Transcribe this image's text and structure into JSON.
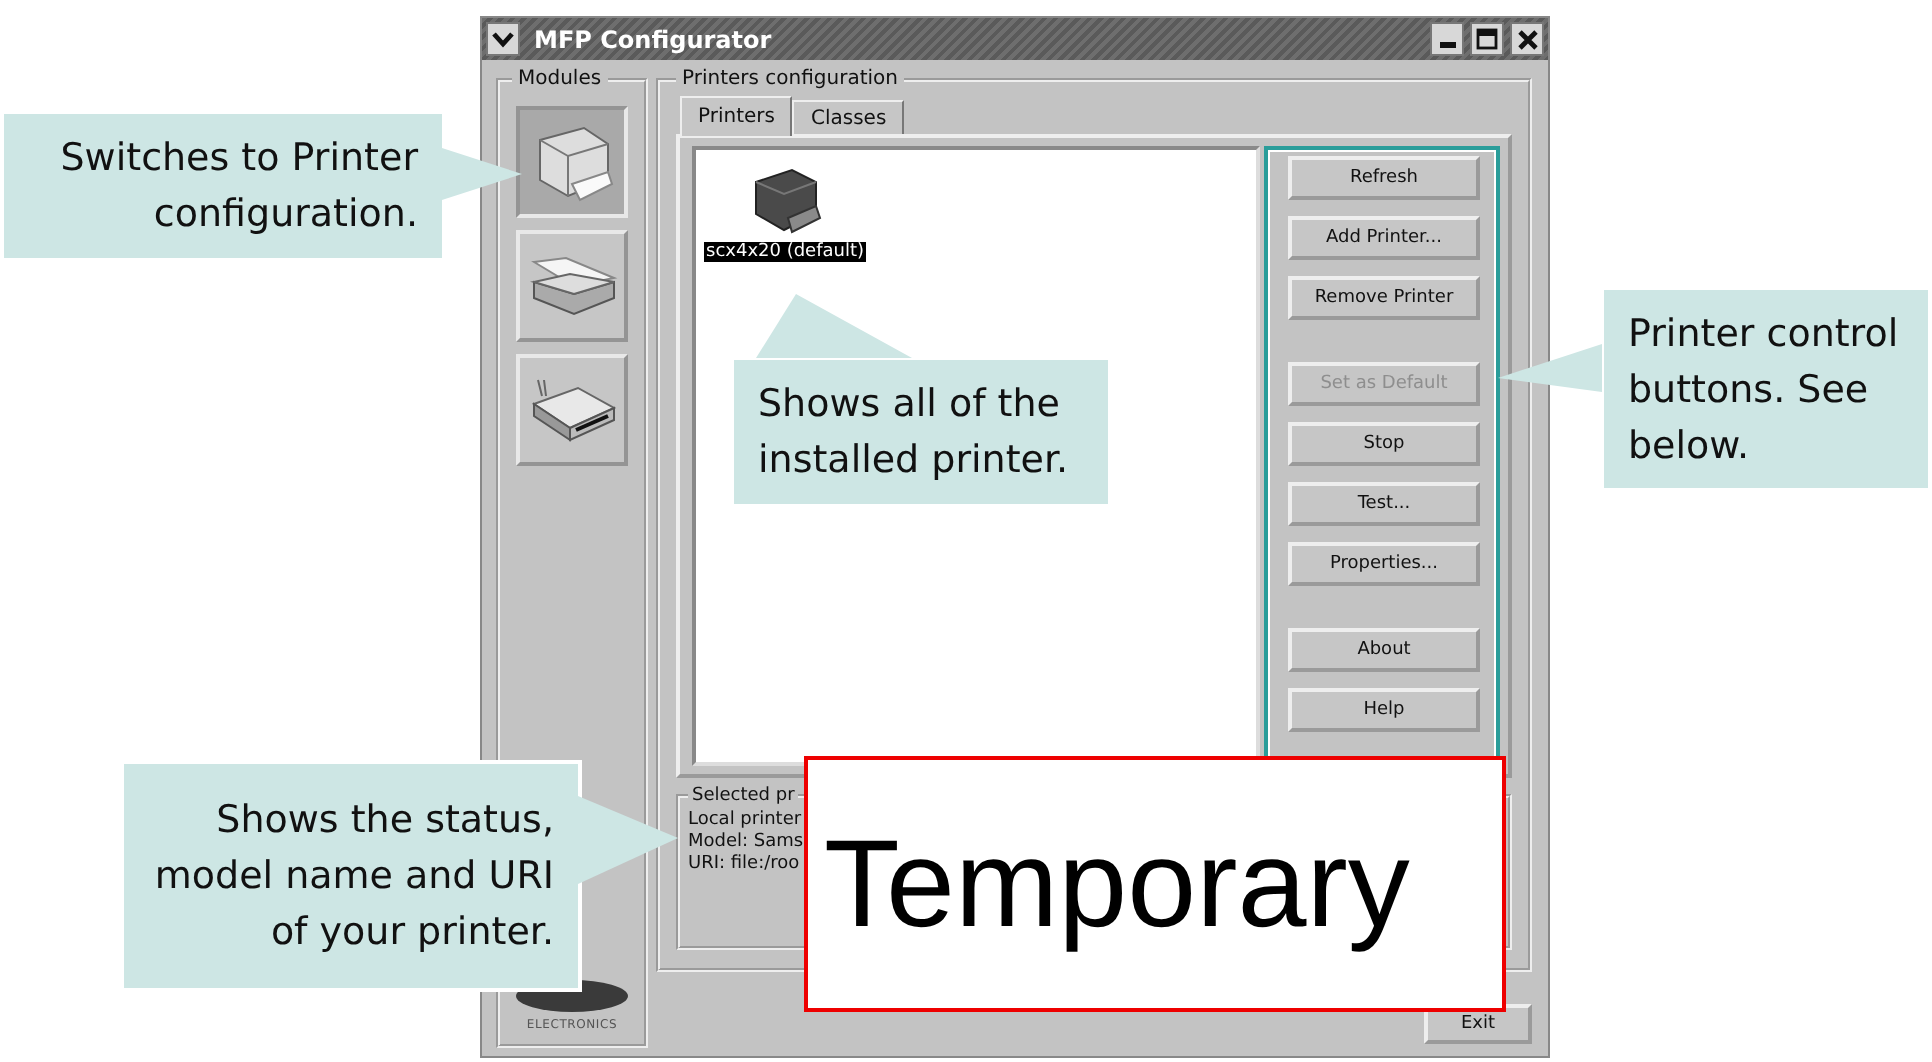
{
  "window": {
    "title": "MFP Configurator"
  },
  "modules": {
    "label": "Modules",
    "items": [
      {
        "kind": "printer",
        "selected": true
      },
      {
        "kind": "scanner",
        "selected": false
      },
      {
        "kind": "port",
        "selected": false
      }
    ],
    "logo_caption": "ELECTRONICS"
  },
  "printers_configuration": {
    "label": "Printers configuration",
    "tabs": [
      {
        "label": "Printers",
        "selected": true
      },
      {
        "label": "Classes",
        "selected": false
      }
    ],
    "printers": [
      {
        "name": "scx4x20 (default)",
        "selected": true
      }
    ],
    "button_groups": [
      [
        {
          "label": "Refresh",
          "disabled": false
        },
        {
          "label": "Add Printer...",
          "disabled": false
        },
        {
          "label": "Remove Printer",
          "disabled": false
        }
      ],
      [
        {
          "label": "Set as Default",
          "disabled": true
        },
        {
          "label": "Stop",
          "disabled": false
        },
        {
          "label": "Test...",
          "disabled": false
        },
        {
          "label": "Properties...",
          "disabled": false
        }
      ],
      [
        {
          "label": "About",
          "disabled": false
        },
        {
          "label": "Help",
          "disabled": false
        }
      ]
    ],
    "selected_printer": {
      "label": "Selected pr",
      "lines": [
        "Local printer",
        "Model: Sams",
        "URI: file:/roo"
      ]
    }
  },
  "exit_button": "Exit",
  "callouts": [
    {
      "text": "Switches to Printer configuration."
    },
    {
      "text": "Shows all of the installed printer."
    },
    {
      "text": "Printer control buttons. See below."
    },
    {
      "text": "Shows the status, model name and URI of your printer."
    }
  ],
  "overlay": {
    "text": "Temporary"
  }
}
